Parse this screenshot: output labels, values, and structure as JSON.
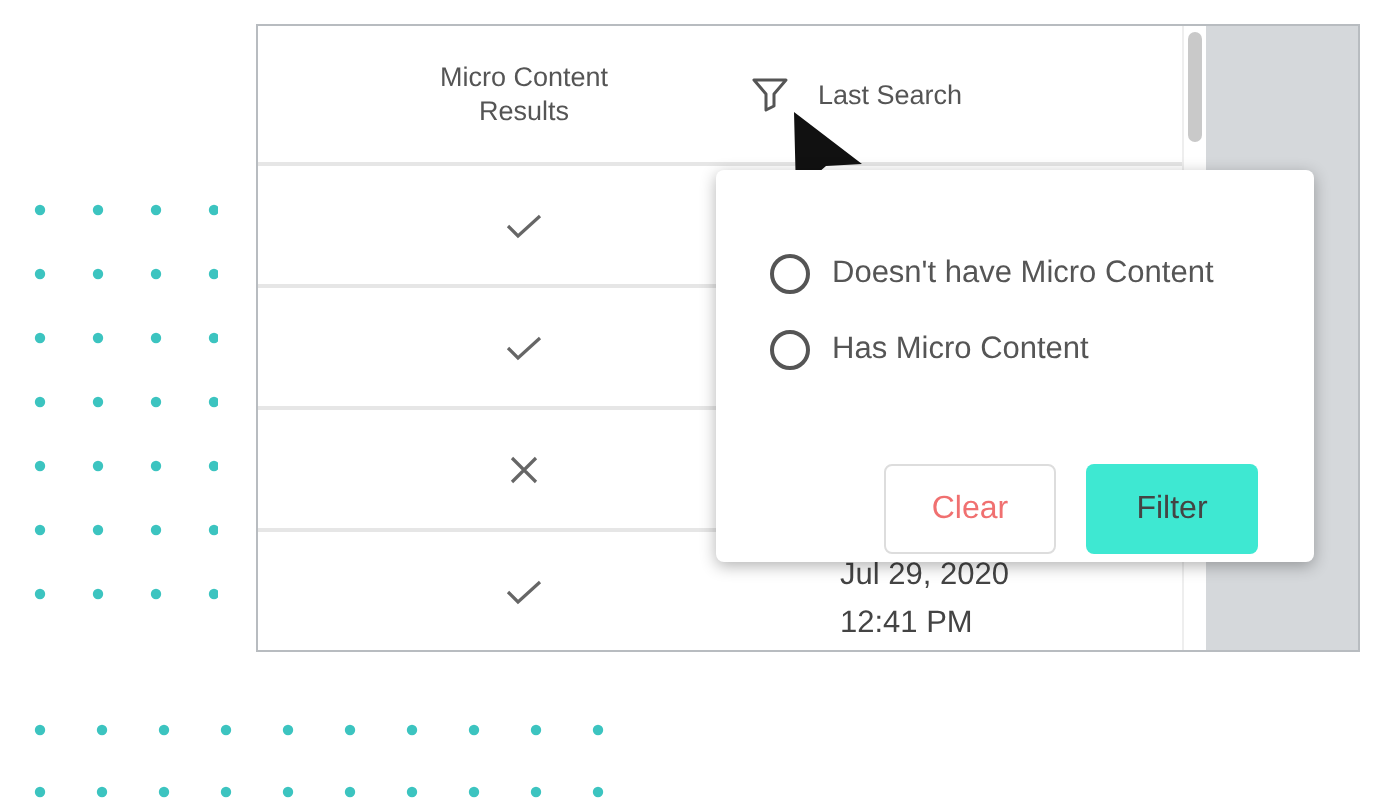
{
  "table": {
    "columns": [
      "Micro Content Results",
      "Last Search"
    ],
    "rows": [
      {
        "has_micro_content": true
      },
      {
        "has_micro_content": true
      },
      {
        "has_micro_content": false
      },
      {
        "has_micro_content": true,
        "last_search": [
          "Jul 29, 2020",
          "12:41 PM"
        ]
      }
    ]
  },
  "filter_popup": {
    "options": [
      {
        "label": "Doesn't have Micro Content",
        "selected": false
      },
      {
        "label": "Has Micro Content",
        "selected": false
      }
    ],
    "buttons": [
      {
        "label": "Clear",
        "kind": "secondary"
      },
      {
        "label": "Filter",
        "kind": "primary"
      }
    ]
  }
}
